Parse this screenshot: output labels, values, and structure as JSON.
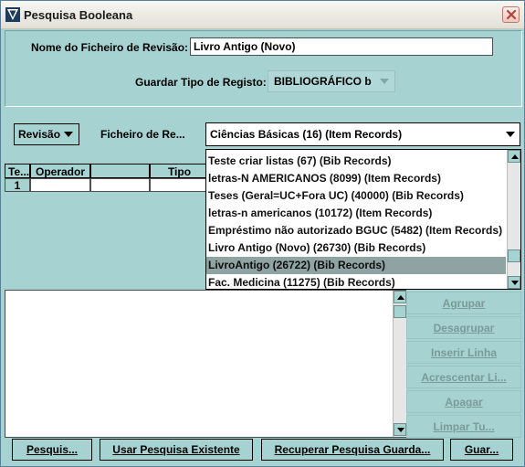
{
  "window": {
    "title": "Pesquisa Booleana"
  },
  "form": {
    "filename_label": "Nome do Ficheiro de Revisão:",
    "filename_value": "Livro Antigo (Novo)",
    "record_type_label": "Guardar Tipo de Registo:",
    "record_type_value": "BIBLIOGRÁFICO  b"
  },
  "filter": {
    "revision_button": "Revisão",
    "review_file_label": "Ficheiro de Re...",
    "review_file_selected": "Ciências Básicas (16) (Item Records)"
  },
  "table": {
    "headers": [
      "Te...",
      "Operador",
      "",
      "Tipo"
    ],
    "rows": [
      [
        "1",
        "",
        "",
        ""
      ]
    ]
  },
  "dropdown": {
    "items": [
      "Teste criar listas (67) (Bib Records)",
      "letras-N AMERICANOS (8099) (Item Records)",
      "Teses (Geral=UC+Fora UC) (40000) (Bib Records)",
      "letras-n americanos (10172) (Item Records)",
      "Empréstimo não autorizado BGUC (5482) (Item Records)",
      "Livro Antigo (Novo) (26730) (Bib Records)",
      "LivroAntigo (26722) (Bib Records)",
      "Fac. Medicina (11275) (Bib Records)"
    ],
    "selected_index": 6
  },
  "side_buttons": [
    "Agrupar",
    "Desagrupar",
    "Inserir Linha",
    "Acrescentar Li...",
    "Apagar",
    "Limpar Tu..."
  ],
  "bottom_buttons": [
    "Pesquis...",
    "Usar Pesquisa Existente",
    "Recuperar Pesquisa Guarda...",
    "Guar..."
  ],
  "colors": {
    "background": "#a6d2d2",
    "selection": "#8fa3a3",
    "disabled_text": "#7b9a9a"
  }
}
